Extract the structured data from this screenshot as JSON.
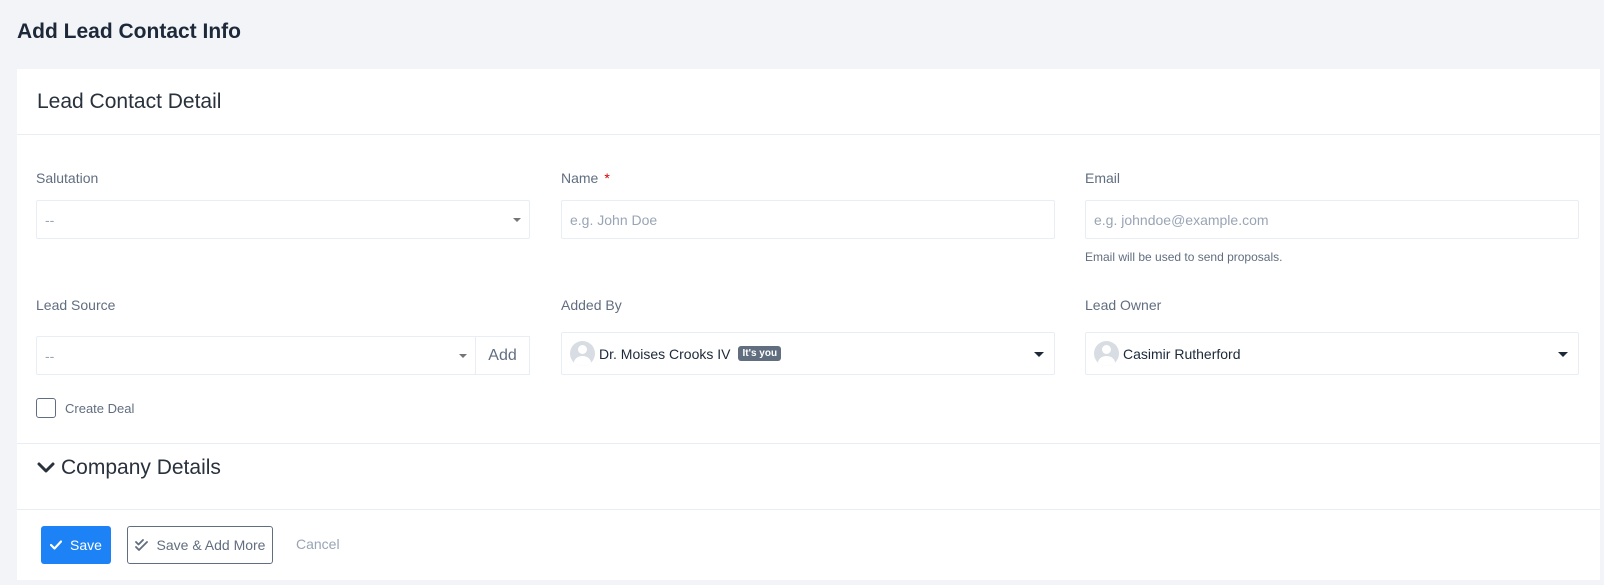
{
  "page": {
    "title": "Add Lead Contact Info"
  },
  "card": {
    "title": "Lead Contact Detail"
  },
  "fields": {
    "salutation": {
      "label": "Salutation",
      "value": "--"
    },
    "name": {
      "label": "Name",
      "required_mark": "*",
      "placeholder": "e.g. John Doe"
    },
    "email": {
      "label": "Email",
      "placeholder": "e.g. johndoe@example.com",
      "help": "Email will be used to send proposals."
    },
    "lead_source": {
      "label": "Lead Source",
      "value": "--",
      "add_label": "Add"
    },
    "added_by": {
      "label": "Added By",
      "value": "Dr. Moises Crooks IV",
      "badge": "It's you"
    },
    "lead_owner": {
      "label": "Lead Owner",
      "value": "Casimir Rutherford"
    },
    "create_deal": {
      "label": "Create Deal",
      "checked": false
    }
  },
  "sections": {
    "company_details": "Company Details"
  },
  "actions": {
    "save": "Save",
    "save_add_more": "Save & Add More",
    "cancel": "Cancel"
  },
  "colors": {
    "primary": "#1d82f5",
    "background": "#f2f4f7",
    "text": "#28313c",
    "muted": "#616e80",
    "required": "#d30000"
  }
}
